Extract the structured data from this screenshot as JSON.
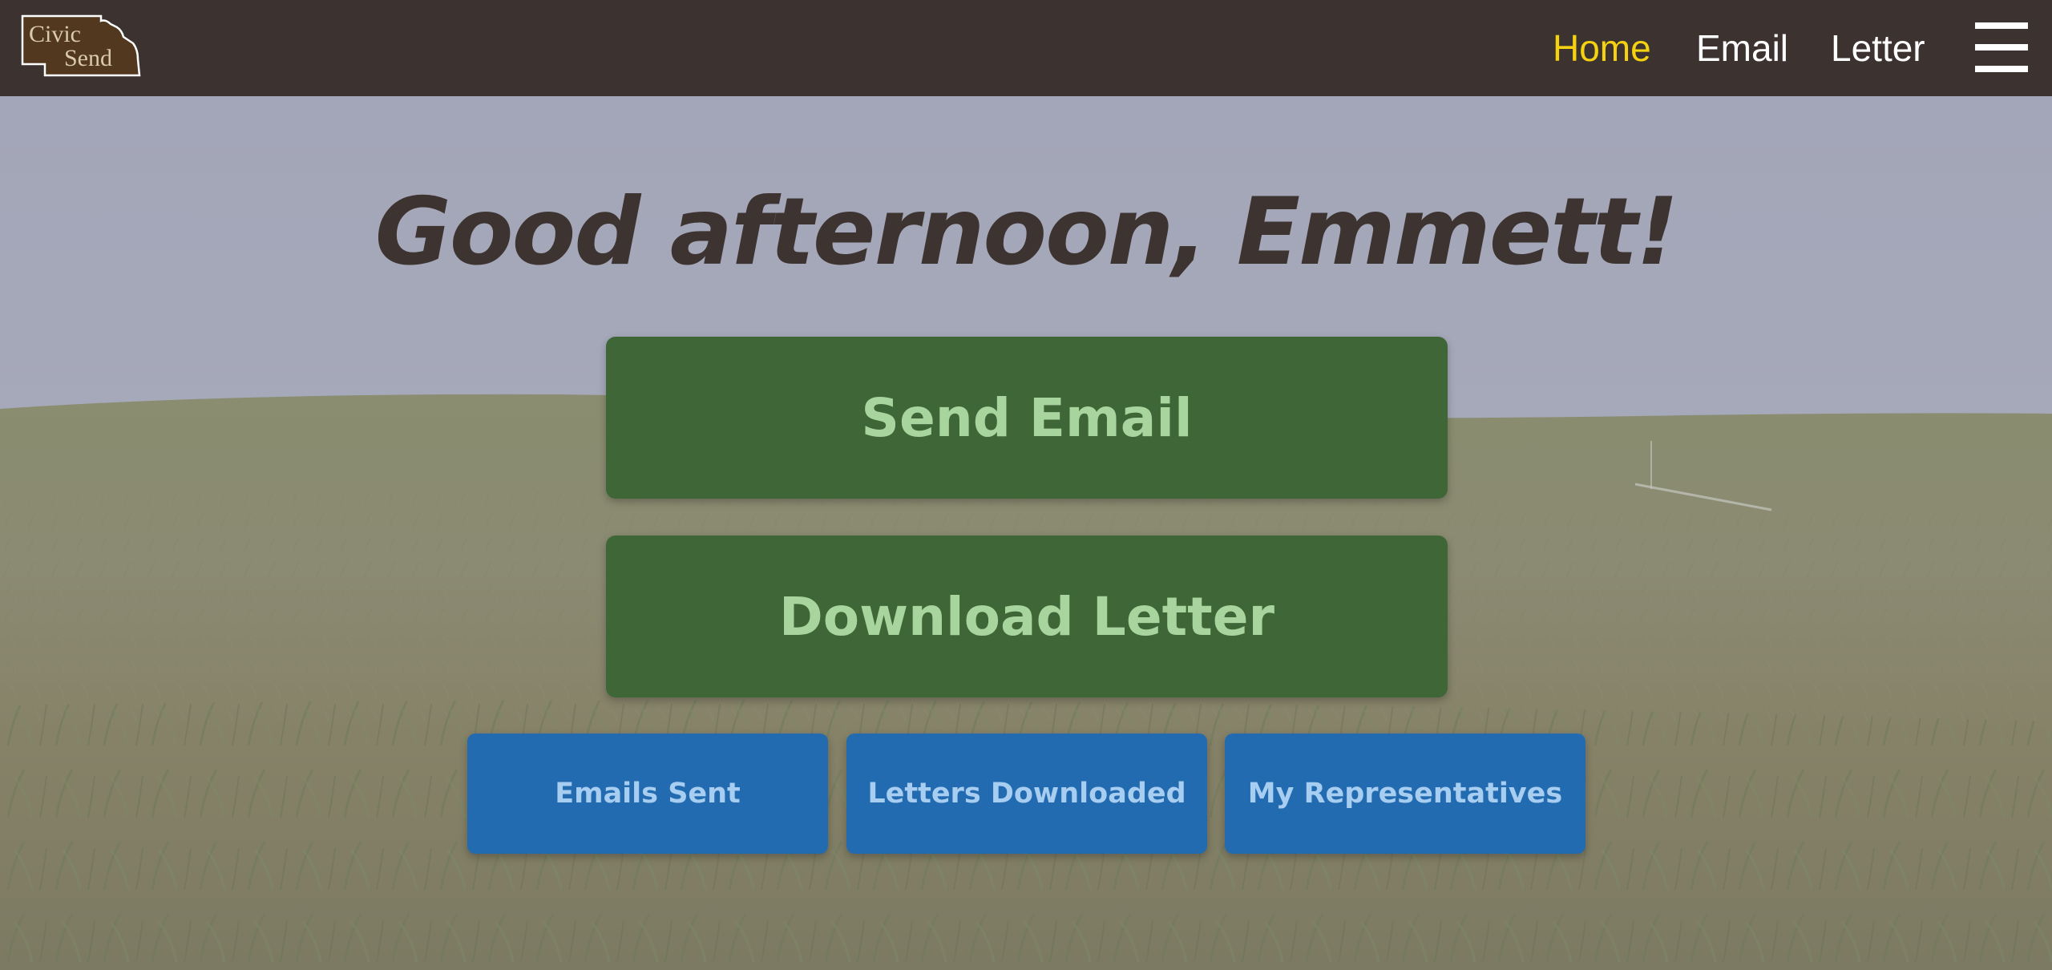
{
  "logo": {
    "line1": "Civic",
    "line2": "Send"
  },
  "nav": {
    "home": "Home",
    "email": "Email",
    "letter": "Letter",
    "menu_icon": "hamburger-menu-icon"
  },
  "hero": {
    "greeting": "Good afternoon, Emmett!",
    "background": "cornfield-photo"
  },
  "actions": {
    "send_email": "Send Email",
    "download_letter": "Download Letter"
  },
  "stats": {
    "emails_sent": "Emails Sent",
    "letters_downloaded": "Letters Downloaded",
    "my_representatives": "My Representatives"
  },
  "colors": {
    "navbar": "#3c3230",
    "nav_active": "#f5d20f",
    "primary_button": "#3f6636",
    "primary_button_text": "#a8d49e",
    "secondary_button": "#236bb0",
    "secondary_button_text": "#a7cdf0",
    "greeting_text": "#3d3331"
  }
}
